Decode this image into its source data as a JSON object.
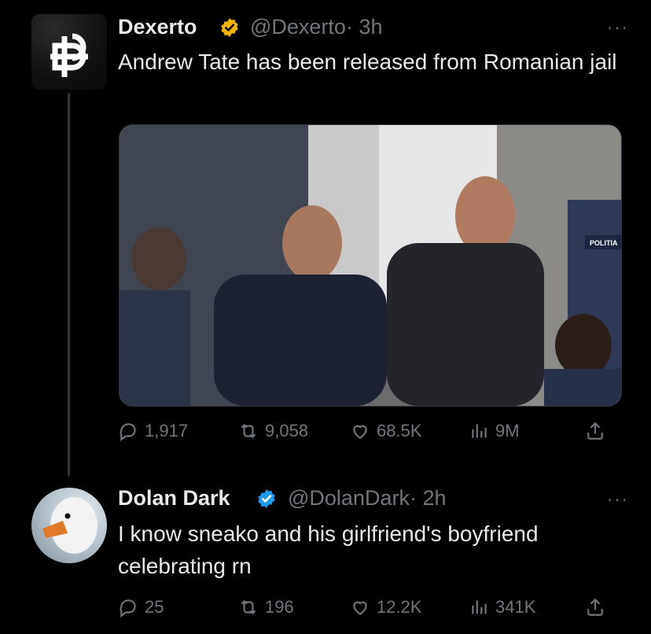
{
  "tweets": [
    {
      "name": "Dexerto",
      "handle": "@Dexerto",
      "time": "· 3h",
      "text": "Andrew Tate has been released from Romanian jail",
      "media_text": "POLITIA",
      "stats": {
        "replies": "1,917",
        "retweets": "9,058",
        "likes": "68.5K",
        "views": "9M"
      },
      "badge_color": "#f4b400"
    },
    {
      "name": "Dolan Dark",
      "handle": "@DolanDark",
      "time": "· 2h",
      "text": "I know sneako and his girlfriend's boyfriend celebrating rn",
      "stats": {
        "replies": "25",
        "retweets": "196",
        "likes": "12.2K",
        "views": "341K"
      },
      "badge_color": "#1d9bf0"
    }
  ],
  "more_label": "···"
}
